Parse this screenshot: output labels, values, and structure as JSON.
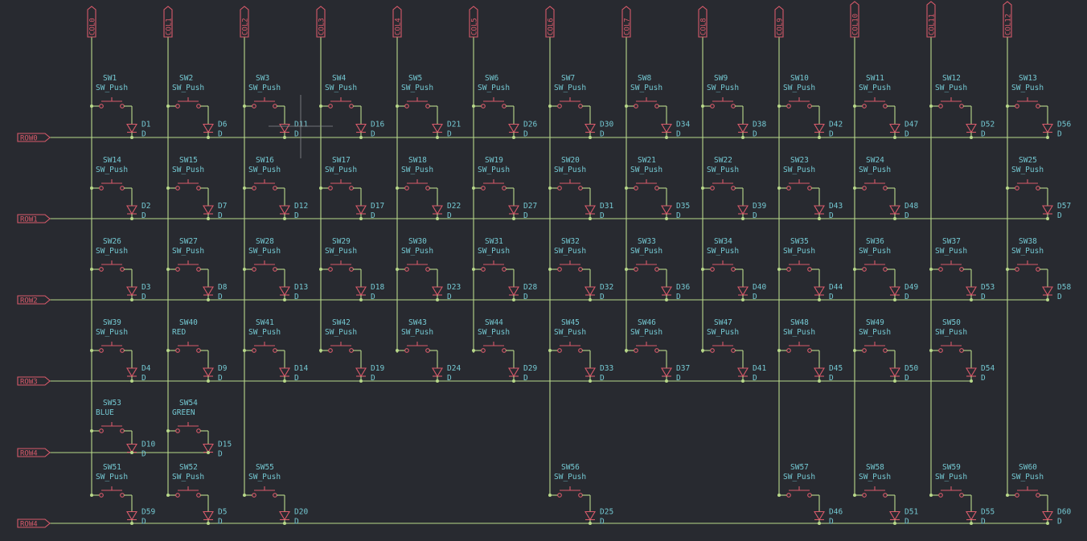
{
  "colors": {
    "background": "#282a30",
    "wire": "#b9d98a",
    "symbol": "#d85a6a",
    "reference_text": "#74c8d2"
  },
  "columns": [
    "COL0",
    "COL1",
    "COL2",
    "COL3",
    "COL4",
    "COL5",
    "COL6",
    "COL7",
    "COL8",
    "COL9",
    "COL10",
    "COL11",
    "COL12"
  ],
  "rows": [
    "ROW0",
    "ROW1",
    "ROW2",
    "ROW3",
    "ROW4",
    "ROW4"
  ],
  "cells": [
    {
      "row": 0,
      "col": 0,
      "sw": "SW1",
      "val": "SW_Push",
      "d": "D1"
    },
    {
      "row": 0,
      "col": 1,
      "sw": "SW2",
      "val": "SW_Push",
      "d": "D6"
    },
    {
      "row": 0,
      "col": 2,
      "sw": "SW3",
      "val": "SW_Push",
      "d": "D11"
    },
    {
      "row": 0,
      "col": 3,
      "sw": "SW4",
      "val": "SW_Push",
      "d": "D16"
    },
    {
      "row": 0,
      "col": 4,
      "sw": "SW5",
      "val": "SW_Push",
      "d": "D21"
    },
    {
      "row": 0,
      "col": 5,
      "sw": "SW6",
      "val": "SW_Push",
      "d": "D26"
    },
    {
      "row": 0,
      "col": 6,
      "sw": "SW7",
      "val": "SW_Push",
      "d": "D30"
    },
    {
      "row": 0,
      "col": 7,
      "sw": "SW8",
      "val": "SW_Push",
      "d": "D34"
    },
    {
      "row": 0,
      "col": 8,
      "sw": "SW9",
      "val": "SW_Push",
      "d": "D38"
    },
    {
      "row": 0,
      "col": 9,
      "sw": "SW10",
      "val": "SW_Push",
      "d": "D42"
    },
    {
      "row": 0,
      "col": 10,
      "sw": "SW11",
      "val": "SW_Push",
      "d": "D47"
    },
    {
      "row": 0,
      "col": 11,
      "sw": "SW12",
      "val": "SW_Push",
      "d": "D52"
    },
    {
      "row": 0,
      "col": 12,
      "sw": "SW13",
      "val": "SW_Push",
      "d": "D56"
    },
    {
      "row": 1,
      "col": 0,
      "sw": "SW14",
      "val": "SW_Push",
      "d": "D2"
    },
    {
      "row": 1,
      "col": 1,
      "sw": "SW15",
      "val": "SW_Push",
      "d": "D7"
    },
    {
      "row": 1,
      "col": 2,
      "sw": "SW16",
      "val": "SW_Push",
      "d": "D12"
    },
    {
      "row": 1,
      "col": 3,
      "sw": "SW17",
      "val": "SW_Push",
      "d": "D17"
    },
    {
      "row": 1,
      "col": 4,
      "sw": "SW18",
      "val": "SW_Push",
      "d": "D22"
    },
    {
      "row": 1,
      "col": 5,
      "sw": "SW19",
      "val": "SW_Push",
      "d": "D27"
    },
    {
      "row": 1,
      "col": 6,
      "sw": "SW20",
      "val": "SW_Push",
      "d": "D31"
    },
    {
      "row": 1,
      "col": 7,
      "sw": "SW21",
      "val": "SW_Push",
      "d": "D35"
    },
    {
      "row": 1,
      "col": 8,
      "sw": "SW22",
      "val": "SW_Push",
      "d": "D39"
    },
    {
      "row": 1,
      "col": 9,
      "sw": "SW23",
      "val": "SW_Push",
      "d": "D43"
    },
    {
      "row": 1,
      "col": 10,
      "sw": "SW24",
      "val": "SW_Push",
      "d": "D48"
    },
    {
      "row": 1,
      "col": 12,
      "sw": "SW25",
      "val": "SW_Push",
      "d": "D57"
    },
    {
      "row": 2,
      "col": 0,
      "sw": "SW26",
      "val": "SW_Push",
      "d": "D3"
    },
    {
      "row": 2,
      "col": 1,
      "sw": "SW27",
      "val": "SW_Push",
      "d": "D8"
    },
    {
      "row": 2,
      "col": 2,
      "sw": "SW28",
      "val": "SW_Push",
      "d": "D13"
    },
    {
      "row": 2,
      "col": 3,
      "sw": "SW29",
      "val": "SW_Push",
      "d": "D18"
    },
    {
      "row": 2,
      "col": 4,
      "sw": "SW30",
      "val": "SW_Push",
      "d": "D23"
    },
    {
      "row": 2,
      "col": 5,
      "sw": "SW31",
      "val": "SW_Push",
      "d": "D28"
    },
    {
      "row": 2,
      "col": 6,
      "sw": "SW32",
      "val": "SW_Push",
      "d": "D32"
    },
    {
      "row": 2,
      "col": 7,
      "sw": "SW33",
      "val": "SW_Push",
      "d": "D36"
    },
    {
      "row": 2,
      "col": 8,
      "sw": "SW34",
      "val": "SW_Push",
      "d": "D40"
    },
    {
      "row": 2,
      "col": 9,
      "sw": "SW35",
      "val": "SW_Push",
      "d": "D44"
    },
    {
      "row": 2,
      "col": 10,
      "sw": "SW36",
      "val": "SW_Push",
      "d": "D49"
    },
    {
      "row": 2,
      "col": 11,
      "sw": "SW37",
      "val": "SW_Push",
      "d": "D53"
    },
    {
      "row": 2,
      "col": 12,
      "sw": "SW38",
      "val": "SW_Push",
      "d": "D58"
    },
    {
      "row": 3,
      "col": 0,
      "sw": "SW39",
      "val": "SW_Push",
      "d": "D4"
    },
    {
      "row": 3,
      "col": 1,
      "sw": "SW40",
      "val": "RED",
      "d": "D9"
    },
    {
      "row": 3,
      "col": 2,
      "sw": "SW41",
      "val": "SW_Push",
      "d": "D14"
    },
    {
      "row": 3,
      "col": 3,
      "sw": "SW42",
      "val": "SW_Push",
      "d": "D19"
    },
    {
      "row": 3,
      "col": 4,
      "sw": "SW43",
      "val": "SW_Push",
      "d": "D24"
    },
    {
      "row": 3,
      "col": 5,
      "sw": "SW44",
      "val": "SW_Push",
      "d": "D29"
    },
    {
      "row": 3,
      "col": 6,
      "sw": "SW45",
      "val": "SW_Push",
      "d": "D33"
    },
    {
      "row": 3,
      "col": 7,
      "sw": "SW46",
      "val": "SW_Push",
      "d": "D37"
    },
    {
      "row": 3,
      "col": 8,
      "sw": "SW47",
      "val": "SW_Push",
      "d": "D41"
    },
    {
      "row": 3,
      "col": 9,
      "sw": "SW48",
      "val": "SW_Push",
      "d": "D45"
    },
    {
      "row": 3,
      "col": 10,
      "sw": "SW49",
      "val": "SW_Push",
      "d": "D50"
    },
    {
      "row": 3,
      "col": 11,
      "sw": "SW50",
      "val": "SW_Push",
      "d": "D54"
    },
    {
      "row": 4,
      "col": 0,
      "sw": "SW53",
      "val": "BLUE",
      "d": "D10"
    },
    {
      "row": 4,
      "col": 1,
      "sw": "SW54",
      "val": "GREEN",
      "d": "D15"
    },
    {
      "row": 5,
      "col": 0,
      "sw": "SW51",
      "val": "SW_Push",
      "d": "D59"
    },
    {
      "row": 5,
      "col": 1,
      "sw": "SW52",
      "val": "SW_Push",
      "d": "D5"
    },
    {
      "row": 5,
      "col": 2,
      "sw": "SW55",
      "val": "SW_Push",
      "d": "D20"
    },
    {
      "row": 5,
      "col": 6,
      "sw": "SW56",
      "val": "SW_Push",
      "d": "D25"
    },
    {
      "row": 5,
      "col": 9,
      "sw": "SW57",
      "val": "SW_Push",
      "d": "D46"
    },
    {
      "row": 5,
      "col": 10,
      "sw": "SW58",
      "val": "SW_Push",
      "d": "D51"
    },
    {
      "row": 5,
      "col": 11,
      "sw": "SW59",
      "val": "SW_Push",
      "d": "D55"
    },
    {
      "row": 5,
      "col": 12,
      "sw": "SW60",
      "val": "SW_Push",
      "d": "D60"
    }
  ],
  "diode_value": "D"
}
